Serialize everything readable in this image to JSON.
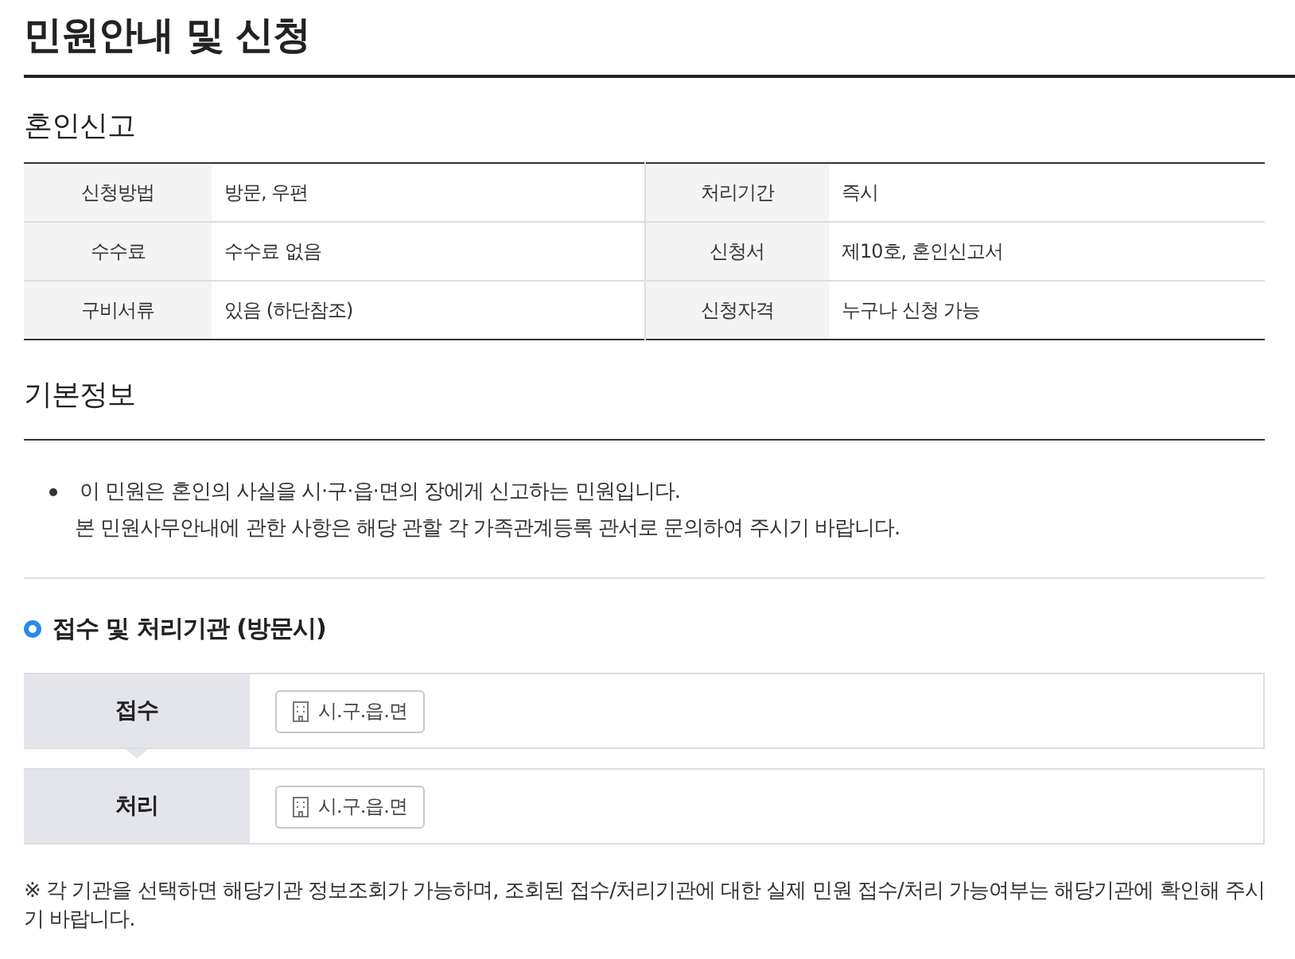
{
  "page_title": "민원안내 및 신청",
  "service": {
    "title": "혼인신고",
    "rows": [
      {
        "cells": [
          {
            "label": "신청방법",
            "value": "방문, 우편"
          },
          {
            "label": "처리기간",
            "value": "즉시"
          }
        ]
      },
      {
        "cells": [
          {
            "label": "수수료",
            "value": "수수료 없음"
          },
          {
            "label": "신청서",
            "value": "제10호, 혼인신고서"
          }
        ]
      },
      {
        "cells": [
          {
            "label": "구비서류",
            "value": "있음 (하단참조)"
          },
          {
            "label": "신청자격",
            "value": "누구나 신청 가능"
          }
        ]
      }
    ]
  },
  "basic_info": {
    "title": "기본정보",
    "items": [
      {
        "text": "이 민원은 혼인의 사실을 시·구·읍·면의 장에게 신고하는 민원입니다.",
        "note": "본 민원사무안내에 관한 사항은 해당 관할 각 가족관계등록 관서로 문의하여 주시기 바랍니다."
      }
    ]
  },
  "agencies": {
    "title": "접수 및 처리기관 (방문시)",
    "steps": [
      {
        "label": "접수",
        "agency": "시.구.읍.면"
      },
      {
        "label": "처리",
        "agency": "시.구.읍.면"
      }
    ]
  },
  "footnote": "※ 각 기관을 선택하면 해당기관 정보조회가 가능하며, 조회된 접수/처리기관에 대한 실제 민원 접수/처리 가능여부는 해당기관에 확인해 주시기 바랍니다."
}
